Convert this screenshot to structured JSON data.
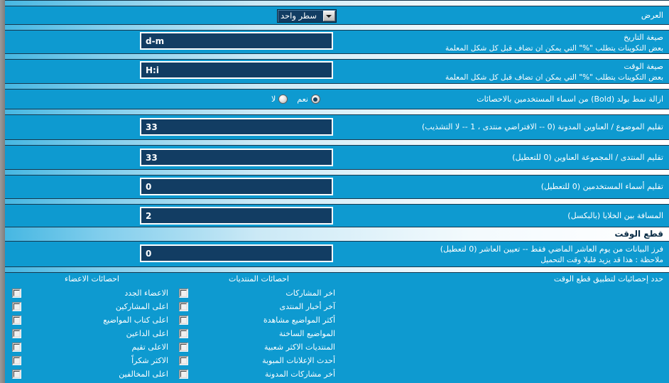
{
  "meta": {
    "accent_bg": "#0e9ad0",
    "input_bg": "#123d63",
    "bar_dark": "#15384f"
  },
  "rows": {
    "display": {
      "label": "العرض",
      "select_value": "سطر واحد",
      "arrow_icon": "chevron-down-icon"
    },
    "date_format": {
      "label": "صيغة التاريخ",
      "sub": "بعض التكوينات يتطلب \"%\" التي يمكن ان تضاف قبل كل شكل المعلمة",
      "value": "d-m"
    },
    "time_format": {
      "label": "صيغة الوقت",
      "sub": "بعض التكوينات يتطلب \"%\" التي يمكن ان تضاف قبل كل شكل المعلمة",
      "value": "H:i"
    },
    "remove_bold": {
      "label": "ازالة نمط بولد (Bold) من اسماء المستخدمين بالاحصائات",
      "options": [
        {
          "label": "نعم",
          "checked": true
        },
        {
          "label": "لا",
          "checked": false
        }
      ]
    },
    "trim_topic": {
      "label": "تقليم الموضوع / العناوين المدونة (0 -- الافتراضي منتدى ، 1 -- لا التشذيب)",
      "value": "33"
    },
    "trim_forum": {
      "label": "تقليم المنتدى / المجموعة العناوين (0 للتعطيل)",
      "value": "33"
    },
    "trim_username": {
      "label": "تقليم أسماء المستخدمين (0 للتعطيل)",
      "value": "0"
    },
    "cell_spacing": {
      "label": "المسافة بين الخلايا (بالبكسل)",
      "value": "2"
    }
  },
  "timecut_section": {
    "title": "قطع الوقت",
    "desc_line1": "فرز البيانات من يوم العاشر الماضي فقط -- تعيين العاشر (0 لتعطيل)",
    "desc_line2": "ملاحظة : هذا قد يزيد قليلا وقت التحميل",
    "value": "0",
    "select_stats_label": "حدد إحصائيات لتطبيق قطع الوقت",
    "columns": [
      {
        "key": "forums",
        "title": "احصائات المنتديات",
        "items": [
          {
            "label": "اخر المشاركات",
            "checked": false
          },
          {
            "label": "آخر أخبار المنتدى",
            "checked": false
          },
          {
            "label": "أكثر المواضيع مشاهدة",
            "checked": false
          },
          {
            "label": "المواضيع الساخنة",
            "checked": false
          },
          {
            "label": "المنتديات الاكثر شعبية",
            "checked": false
          },
          {
            "label": "أحدث الإعلانات المبوبة",
            "checked": false
          },
          {
            "label": "أخر مشاركات المدونة",
            "checked": false
          }
        ]
      },
      {
        "key": "members",
        "title": "احصائات الاعضاء",
        "items": [
          {
            "label": "الاعضاء الجدد",
            "checked": false
          },
          {
            "label": "اعلى المشاركين",
            "checked": false
          },
          {
            "label": "اعلى كتاب المواضيع",
            "checked": false
          },
          {
            "label": "اعلى الداعين",
            "checked": false
          },
          {
            "label": "الاعلى تقيم",
            "checked": false
          },
          {
            "label": "الاكثر شكراً",
            "checked": false
          },
          {
            "label": "اعلى المخالفين",
            "checked": false
          }
        ]
      }
    ]
  }
}
